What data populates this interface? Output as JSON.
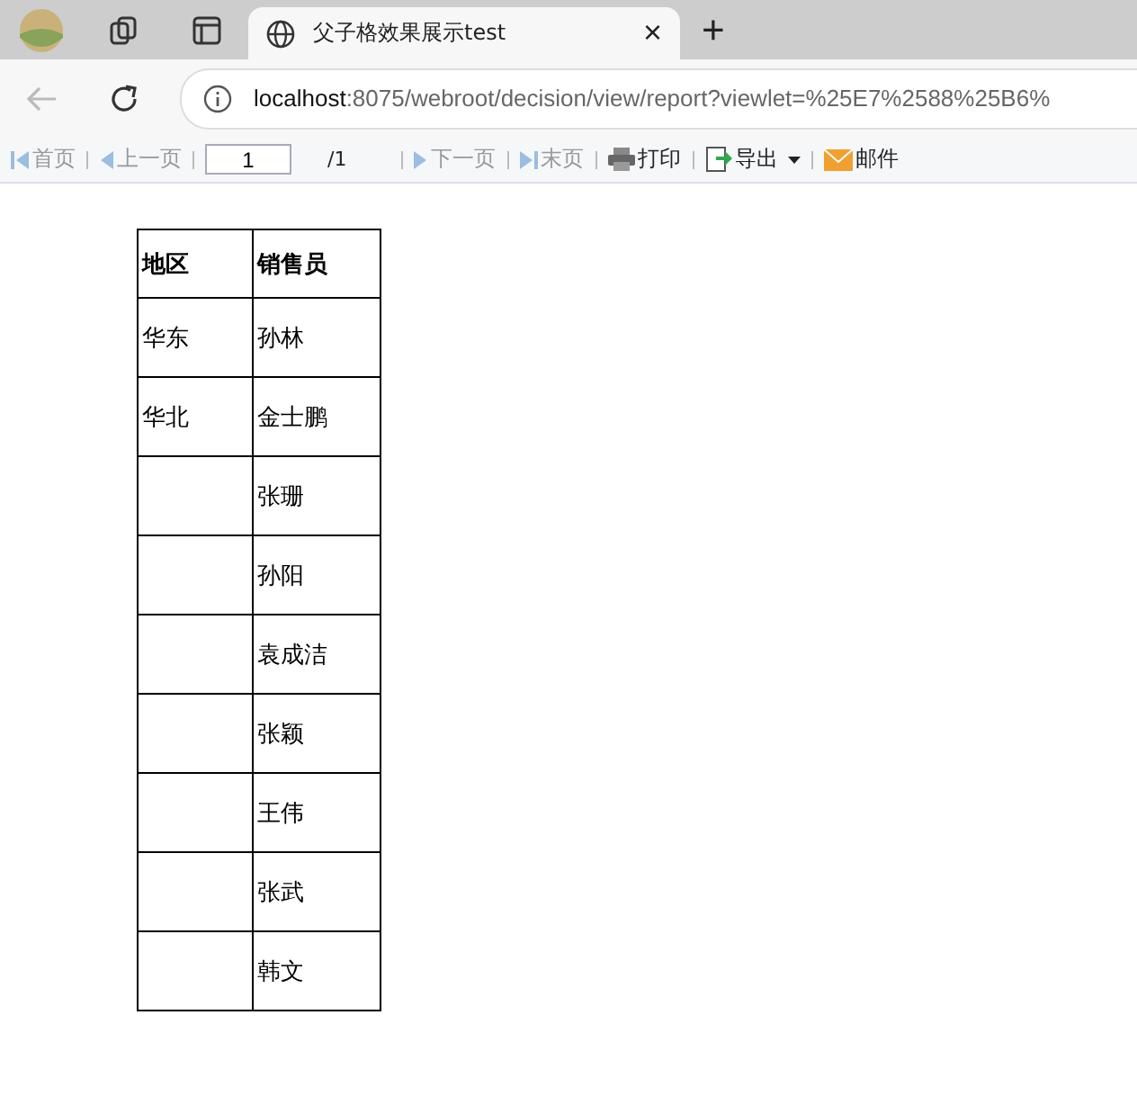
{
  "browser": {
    "tab": {
      "title": "父子格效果展示test",
      "close": "×"
    },
    "new_tab": "+",
    "url": {
      "host": "localhost",
      "path": ":8075/webroot/decision/view/report?viewlet=%25E7%2588%25B6%"
    }
  },
  "toolbar": {
    "items": [
      {
        "kind": "nav",
        "label": "首页",
        "disabled": true
      },
      {
        "kind": "nav",
        "label": "上一页",
        "disabled": true
      },
      {
        "kind": "page",
        "value": "1",
        "total": "/1"
      },
      {
        "kind": "nav",
        "label": "下一页",
        "disabled": true
      },
      {
        "kind": "nav",
        "label": "末页",
        "disabled": true
      },
      {
        "kind": "nav",
        "label": "打印",
        "disabled": false
      },
      {
        "kind": "nav",
        "label": "导出",
        "disabled": false,
        "dropdown": true
      },
      {
        "kind": "nav",
        "label": "邮件",
        "disabled": false
      }
    ]
  },
  "table": {
    "columns": [
      "地区",
      "销售员"
    ],
    "rows": [
      {
        "region": "华东",
        "salesperson": "孙林"
      },
      {
        "region": "华北",
        "salesperson": "金士鹏"
      },
      {
        "salesperson": "张珊"
      },
      {
        "salesperson": "孙阳"
      },
      {
        "salesperson": "袁成洁"
      },
      {
        "salesperson": "张颖"
      },
      {
        "salesperson": "王伟"
      },
      {
        "salesperson": "张武"
      },
      {
        "salesperson": "韩文"
      }
    ]
  }
}
